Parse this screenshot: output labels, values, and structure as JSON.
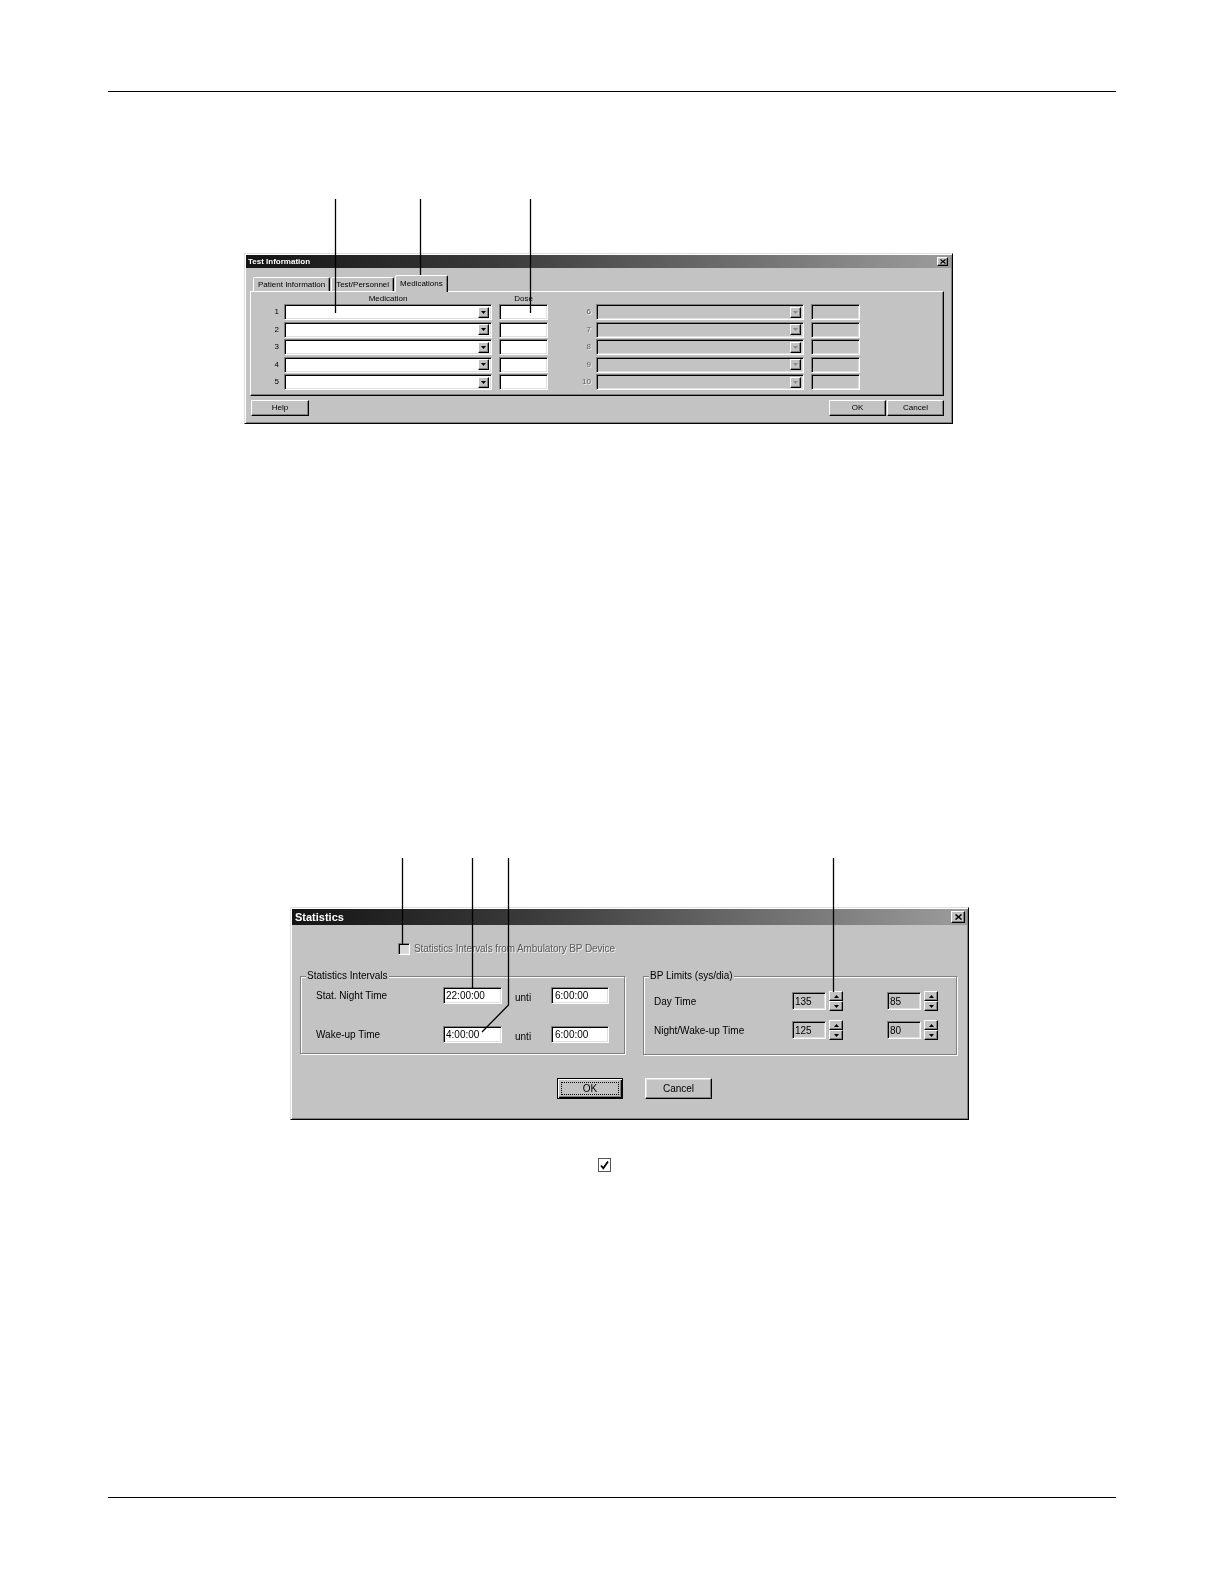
{
  "test_information": {
    "title": "Test Information",
    "tabs": [
      {
        "label": "Patient Information",
        "selected": false
      },
      {
        "label": "Test/Personnel",
        "selected": false
      },
      {
        "label": "Medications",
        "selected": true
      }
    ],
    "medication_header": "Medication",
    "dose_header": "Dose",
    "rows": [
      {
        "number": "1",
        "disabled": false
      },
      {
        "number": "2",
        "disabled": false
      },
      {
        "number": "3",
        "disabled": false
      },
      {
        "number": "4",
        "disabled": false
      },
      {
        "number": "5",
        "disabled": false
      },
      {
        "number": "6",
        "disabled": true
      },
      {
        "number": "7",
        "disabled": true
      },
      {
        "number": "8",
        "disabled": true
      },
      {
        "number": "9",
        "disabled": true
      },
      {
        "number": "10",
        "disabled": true
      }
    ],
    "help_button": "Help",
    "ok_button": "OK",
    "cancel_button": "Cancel"
  },
  "statistics": {
    "title": "Statistics",
    "checkbox": {
      "label": "Statistics Intervals from Ambulatory BP Device",
      "checked": false,
      "disabled": true
    },
    "intervals": {
      "title": "Statistics Intervals",
      "rows": [
        {
          "label": "Stat. Night Time",
          "from": "22:00:00",
          "until": "unti",
          "to": "6:00:00"
        },
        {
          "label": "Wake-up Time",
          "from": "4:00:00",
          "until": "unti",
          "to": "6:00:00"
        }
      ]
    },
    "bp_limits": {
      "title": "BP Limits (sys/dia)",
      "rows": [
        {
          "label": "Day Time",
          "sys": "135",
          "dia": "85"
        },
        {
          "label": "Night/Wake-up Time",
          "sys": "125",
          "dia": "80"
        }
      ]
    },
    "ok_button": {
      "label": "OK",
      "default": true
    },
    "cancel_button": {
      "label": "Cancel",
      "default": false
    }
  }
}
